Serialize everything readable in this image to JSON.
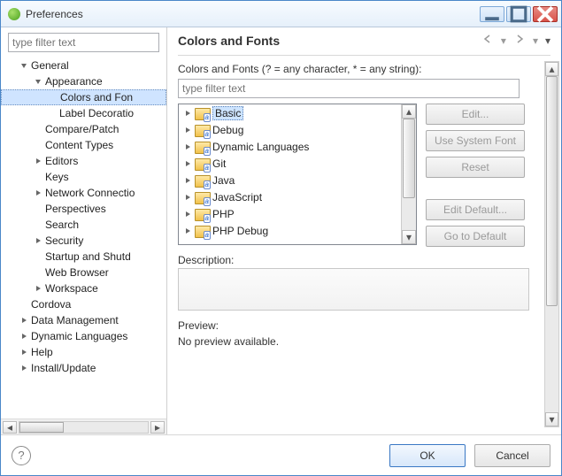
{
  "window": {
    "title": "Preferences"
  },
  "sidebar": {
    "filter_placeholder": "type filter text",
    "items": [
      {
        "label": "General",
        "depth": 1,
        "expandable": true,
        "expanded": true,
        "selected": false
      },
      {
        "label": "Appearance",
        "depth": 2,
        "expandable": true,
        "expanded": true,
        "selected": false
      },
      {
        "label": "Colors and Fon",
        "depth": 3,
        "expandable": false,
        "selected": true
      },
      {
        "label": "Label Decoratio",
        "depth": 3,
        "expandable": false,
        "selected": false
      },
      {
        "label": "Compare/Patch",
        "depth": 2,
        "expandable": false,
        "selected": false
      },
      {
        "label": "Content Types",
        "depth": 2,
        "expandable": false,
        "selected": false
      },
      {
        "label": "Editors",
        "depth": 2,
        "expandable": true,
        "expanded": false,
        "selected": false
      },
      {
        "label": "Keys",
        "depth": 2,
        "expandable": false,
        "selected": false
      },
      {
        "label": "Network Connectio",
        "depth": 2,
        "expandable": true,
        "expanded": false,
        "selected": false
      },
      {
        "label": "Perspectives",
        "depth": 2,
        "expandable": false,
        "selected": false
      },
      {
        "label": "Search",
        "depth": 2,
        "expandable": false,
        "selected": false
      },
      {
        "label": "Security",
        "depth": 2,
        "expandable": true,
        "expanded": false,
        "selected": false
      },
      {
        "label": "Startup and Shutd",
        "depth": 2,
        "expandable": false,
        "selected": false
      },
      {
        "label": "Web Browser",
        "depth": 2,
        "expandable": false,
        "selected": false
      },
      {
        "label": "Workspace",
        "depth": 2,
        "expandable": true,
        "expanded": false,
        "selected": false
      },
      {
        "label": "Cordova",
        "depth": 1,
        "expandable": false,
        "selected": false
      },
      {
        "label": "Data Management",
        "depth": 1,
        "expandable": true,
        "expanded": false,
        "selected": false
      },
      {
        "label": "Dynamic Languages",
        "depth": 1,
        "expandable": true,
        "expanded": false,
        "selected": false
      },
      {
        "label": "Help",
        "depth": 1,
        "expandable": true,
        "expanded": false,
        "selected": false
      },
      {
        "label": "Install/Update",
        "depth": 1,
        "expandable": true,
        "expanded": false,
        "selected": false
      }
    ]
  },
  "main": {
    "title": "Colors and Fonts",
    "sublabel": "Colors and Fonts (? = any character, * = any string):",
    "filter_placeholder": "type filter text",
    "categories": [
      {
        "label": "Basic",
        "selected": true
      },
      {
        "label": "Debug",
        "selected": false
      },
      {
        "label": "Dynamic Languages",
        "selected": false
      },
      {
        "label": "Git",
        "selected": false
      },
      {
        "label": "Java",
        "selected": false
      },
      {
        "label": "JavaScript",
        "selected": false
      },
      {
        "label": "PHP",
        "selected": false
      },
      {
        "label": "PHP Debug",
        "selected": false
      }
    ],
    "buttons": {
      "edit": "Edit...",
      "use_system_font": "Use System Font",
      "reset": "Reset",
      "edit_default": "Edit Default...",
      "go_to_default": "Go to Default"
    },
    "description_label": "Description:",
    "preview_label": "Preview:",
    "preview_text": "No preview available."
  },
  "footer": {
    "ok": "OK",
    "cancel": "Cancel"
  }
}
